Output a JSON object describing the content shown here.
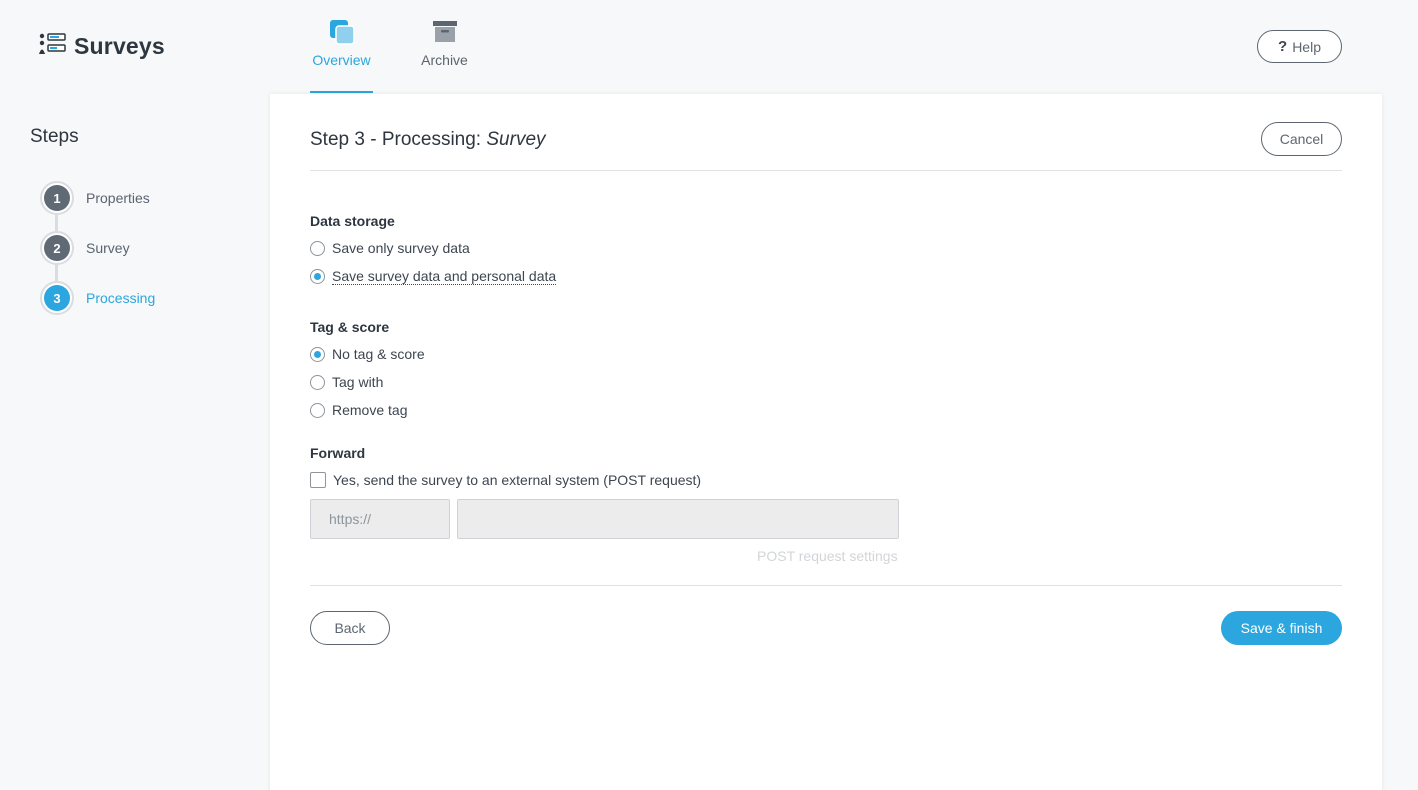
{
  "app": {
    "title": "Surveys",
    "icon": "survey-list-icon"
  },
  "tabs": [
    {
      "label": "Overview",
      "icon": "overview-icon",
      "active": true
    },
    {
      "label": "Archive",
      "icon": "archive-icon",
      "active": false
    }
  ],
  "help": {
    "label": "Help",
    "icon": "question-icon"
  },
  "sidebar": {
    "title": "Steps",
    "steps": [
      {
        "number": "1",
        "label": "Properties",
        "active": false
      },
      {
        "number": "2",
        "label": "Survey",
        "active": false
      },
      {
        "number": "3",
        "label": "Processing",
        "active": true
      }
    ]
  },
  "main": {
    "title_prefix": "Step 3 - Processing: ",
    "title_name": "Survey",
    "cancel_label": "Cancel",
    "data_storage": {
      "label": "Data storage",
      "options": [
        {
          "label": "Save only survey data",
          "checked": false
        },
        {
          "label": "Save survey data and personal data",
          "checked": true
        }
      ]
    },
    "tag_score": {
      "label": "Tag & score",
      "options": [
        {
          "label": "No tag & score",
          "checked": true
        },
        {
          "label": "Tag with",
          "checked": false
        },
        {
          "label": "Remove tag",
          "checked": false
        }
      ]
    },
    "forward": {
      "label": "Forward",
      "checkbox_label": "Yes, send the survey to an external system (POST request)",
      "checked": false,
      "protocol_value": "https://",
      "url_value": "",
      "post_settings_label": "POST request settings"
    },
    "back_label": "Back",
    "save_label": "Save & finish"
  },
  "colors": {
    "accent": "#2ba6de",
    "step_inactive": "#5f6a75"
  }
}
